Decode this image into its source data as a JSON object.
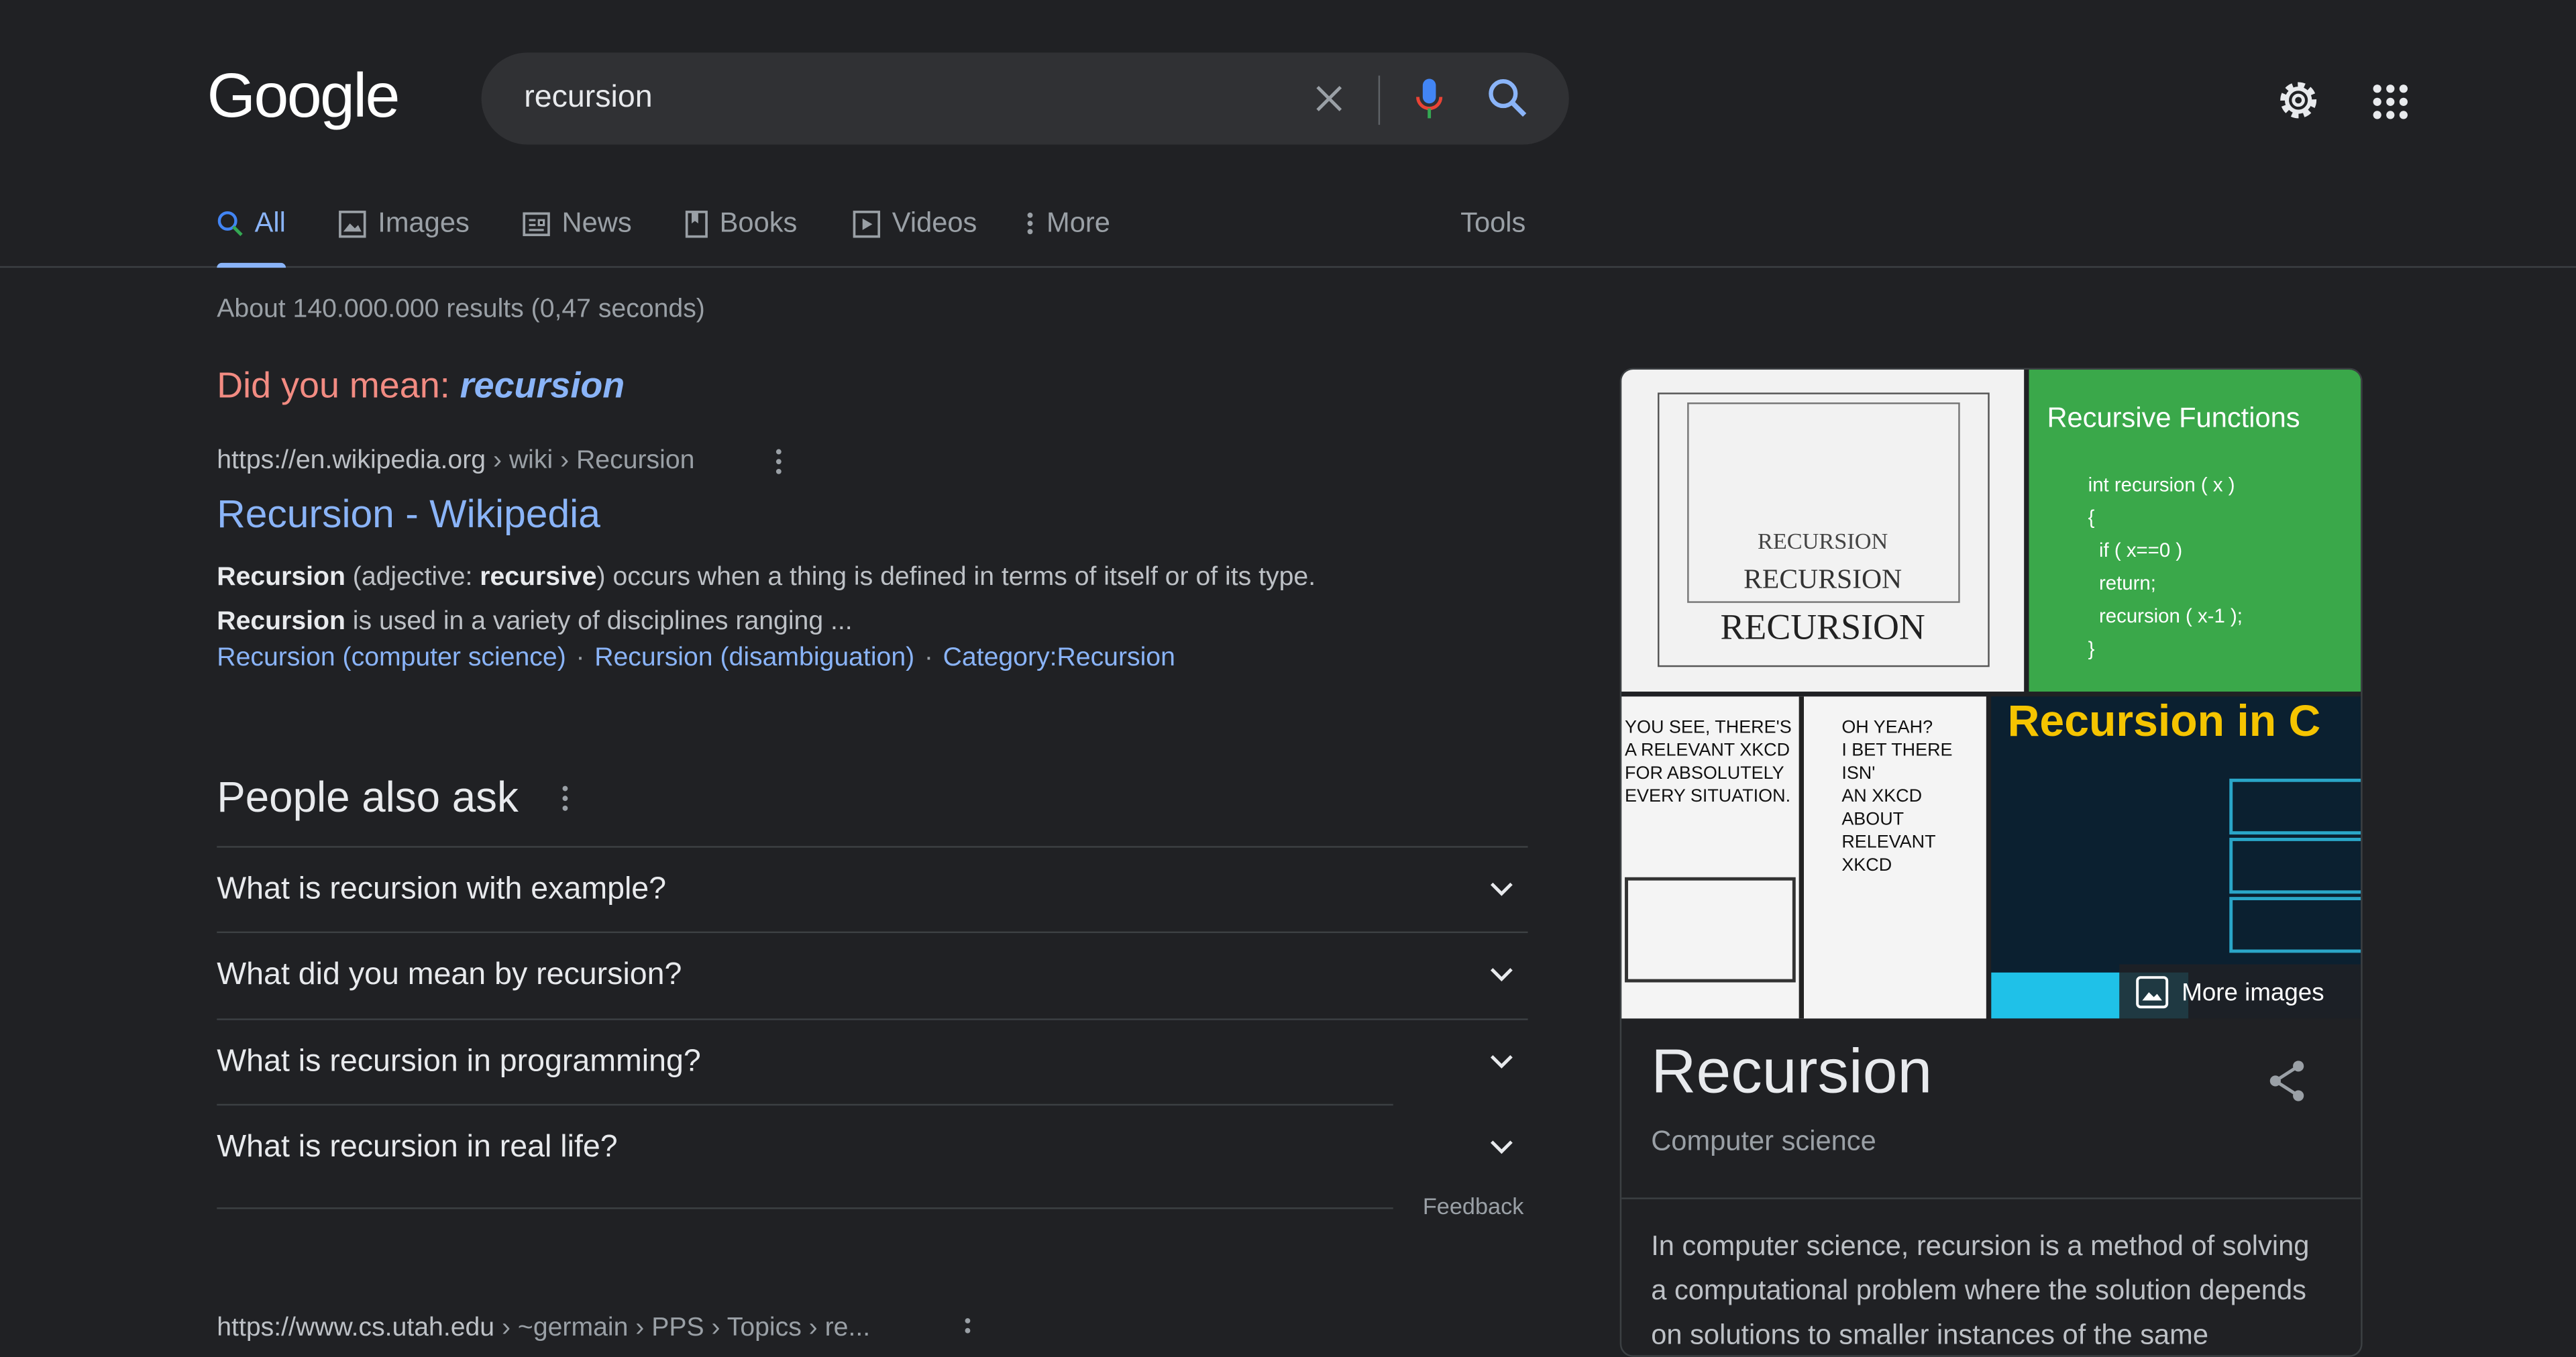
{
  "header": {
    "logo": "Google",
    "query": "recursion"
  },
  "tabs": [
    {
      "label": "All",
      "icon": "search-icon"
    },
    {
      "label": "Images",
      "icon": "image-icon"
    },
    {
      "label": "News",
      "icon": "news-icon"
    },
    {
      "label": "Books",
      "icon": "book-icon"
    },
    {
      "label": "Videos",
      "icon": "video-icon"
    },
    {
      "label": "More",
      "icon": "more-vert-icon"
    }
  ],
  "tools_label": "Tools",
  "stats": "About 140.000.000 results (0,47 seconds)",
  "did_you_mean": {
    "prefix": "Did you mean: ",
    "term": "recursion"
  },
  "result1": {
    "url": "https://en.wikipedia.org",
    "path": " › wiki › Recursion",
    "title": "Recursion - Wikipedia",
    "s1b": "Recursion",
    "s1a": " (adjective: ",
    "s1c": "recursive",
    "s1d": ") occurs when a thing is defined in terms of itself or of its type.",
    "s2b": "Recursion",
    "s2a": " is used in a variety of disciplines ranging ...",
    "links": [
      "Recursion (computer science)",
      "Recursion (disambiguation)",
      "Category:Recursion"
    ]
  },
  "people_also_ask": {
    "title": "People also ask",
    "questions": [
      "What is recursion with example?",
      "What did you mean by recursion?",
      "What is recursion in programming?",
      "What is recursion in real life?"
    ],
    "feedback": "Feedback"
  },
  "result2": {
    "url": "https://www.cs.utah.edu",
    "path": " › ~germain › PPS › Topics › re..."
  },
  "knowledge_panel": {
    "img_captions": {
      "recursive_functions": "Recursive Functions",
      "recursion_in_c": "Recursion in C",
      "recursion_word": "RECURSION"
    },
    "more_images": "More images",
    "title": "Recursion",
    "subtitle": "Computer science",
    "description": "In computer science, recursion is a method of solving a computational problem where the solution depends on solutions to smaller instances of the same"
  },
  "colors": {
    "bg": "#202124",
    "link": "#8ab4f8",
    "dym": "#f28b82"
  }
}
